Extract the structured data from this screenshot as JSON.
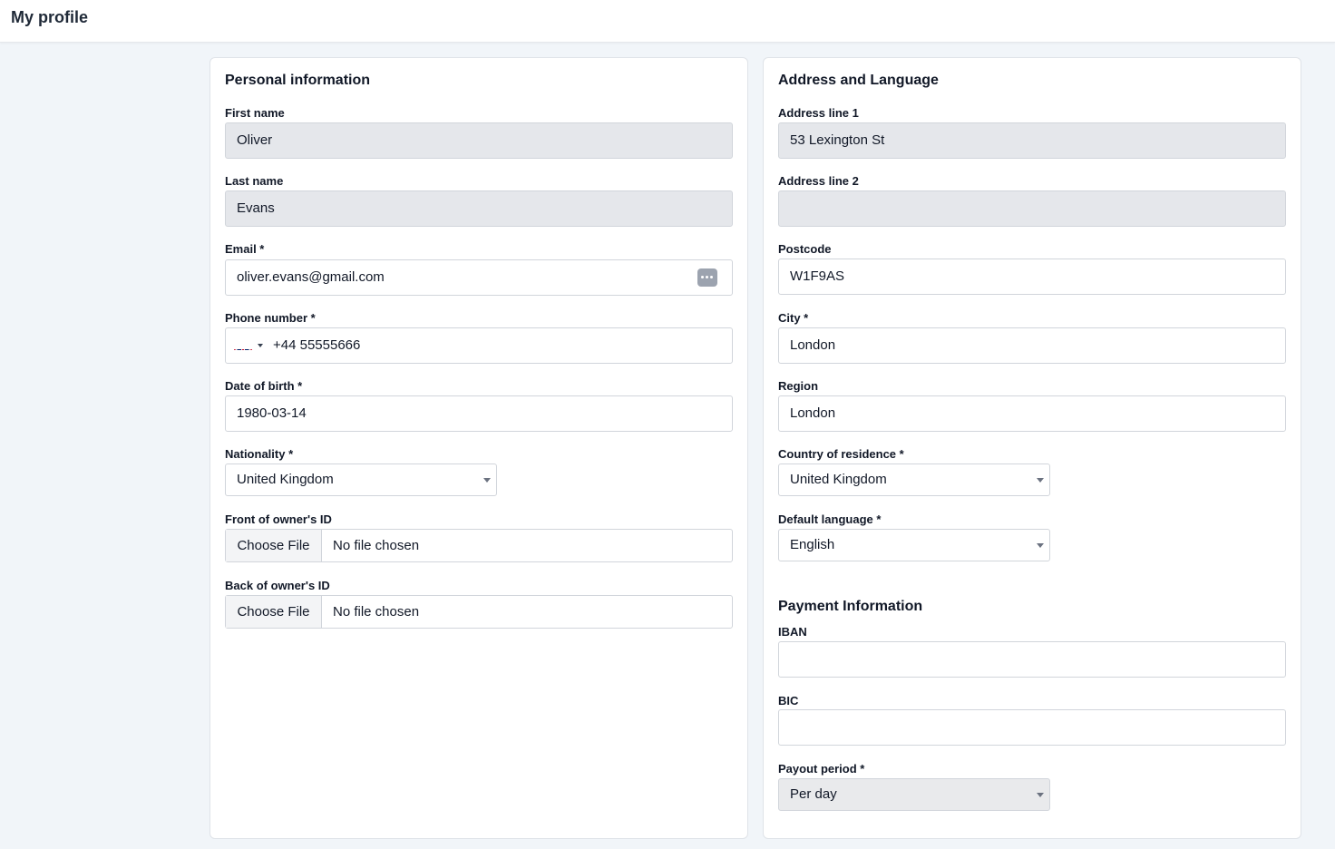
{
  "page": {
    "title": "My profile"
  },
  "personal": {
    "title": "Personal information",
    "first_name": {
      "label": "First name",
      "value": "Oliver"
    },
    "last_name": {
      "label": "Last name",
      "value": "Evans"
    },
    "email": {
      "label": "Email *",
      "value": "oliver.evans@gmail.com",
      "icon": "password-manager-icon"
    },
    "phone": {
      "label": "Phone number *",
      "value": "+44 55555666",
      "flag": "uk-flag-icon"
    },
    "dob": {
      "label": "Date of birth *",
      "value": "1980-03-14"
    },
    "nationality": {
      "label": "Nationality *",
      "value": "United Kingdom"
    },
    "front_id": {
      "label": "Front of owner's ID",
      "button": "Choose File",
      "status": "No file chosen"
    },
    "back_id": {
      "label": "Back of owner's ID",
      "button": "Choose File",
      "status": "No file chosen"
    }
  },
  "address": {
    "title": "Address and Language",
    "line1": {
      "label": "Address line 1",
      "value": "53 Lexington St"
    },
    "line2": {
      "label": "Address line 2",
      "value": ""
    },
    "postcode": {
      "label": "Postcode",
      "value": "W1F9AS"
    },
    "city": {
      "label": "City *",
      "value": "London"
    },
    "region": {
      "label": "Region",
      "value": "London"
    },
    "country": {
      "label": "Country of residence *",
      "value": "United Kingdom"
    },
    "language": {
      "label": "Default language *",
      "value": "English"
    }
  },
  "payment": {
    "title": "Payment Information",
    "iban": {
      "label": "IBAN",
      "value": ""
    },
    "bic": {
      "label": "BIC",
      "value": ""
    },
    "payout": {
      "label": "Payout period *",
      "value": "Per day"
    }
  },
  "colors": {
    "background": "#f1f5f9",
    "readonly_field": "#e5e7eb",
    "border": "#d1d5db"
  }
}
